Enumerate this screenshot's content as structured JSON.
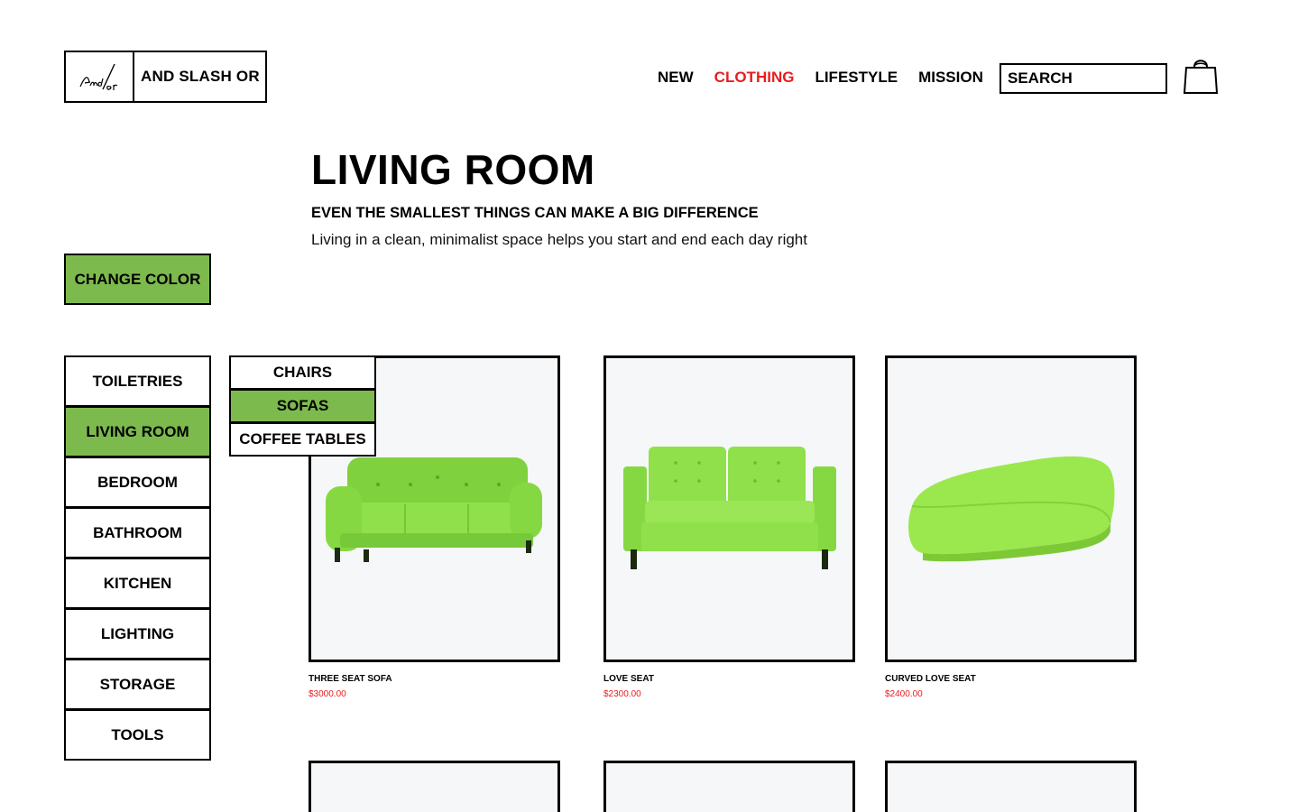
{
  "header": {
    "logo_mark_text": "And/or",
    "brand_name": "AND SLASH OR",
    "nav": [
      "NEW",
      "CLOTHING",
      "LIFESTYLE",
      "MISSION"
    ],
    "active_nav": "CLOTHING",
    "search_placeholder": "SEARCH",
    "cart_icon": "shopping-bag-icon"
  },
  "hero": {
    "title": "LIVING ROOM",
    "subtitle": "EVEN THE SMALLEST THINGS CAN MAKE A BIG DIFFERENCE",
    "description": "Living in a clean, minimalist space helps you start and end each day right"
  },
  "change_color_label": "CHANGE COLOR",
  "categories": [
    "TOILETRIES",
    "LIVING ROOM",
    "BEDROOM",
    "BATHROOM",
    "KITCHEN",
    "LIGHTING",
    "STORAGE",
    "TOOLS"
  ],
  "active_category": "LIVING ROOM",
  "subcategories": [
    "CHAIRS",
    "SOFAS",
    "COFFEE TABLES"
  ],
  "active_subcategory": "SOFAS",
  "products": [
    {
      "name": "THREE SEAT SOFA",
      "price": "$3000.00",
      "image": "three-seat-sofa"
    },
    {
      "name": "LOVE SEAT",
      "price": "$2300.00",
      "image": "love-seat"
    },
    {
      "name": "CURVED LOVE SEAT",
      "price": "$2400.00",
      "image": "curved-love-seat"
    }
  ],
  "colors": {
    "accent_green": "#7dba4e",
    "active_red": "#ea1c1c",
    "product_green": "#8fe04a",
    "card_bg": "#f5f7f9"
  }
}
